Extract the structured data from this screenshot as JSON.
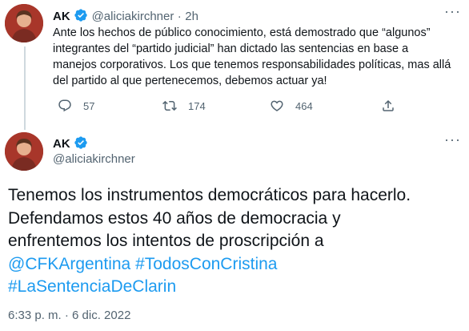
{
  "tweet1": {
    "author_name": "AK",
    "handle": "@aliciakirchner",
    "separator": "·",
    "time_ago": "2h",
    "more": "···",
    "text": "Ante los hechos de público conocimiento, está demostrado que “algunos” integrantes del “partido judicial” han dictado las sentencias en base a manejos corporativos. Los que tenemos responsabilidades políticas, mas allá del partido al que pertenecemos, debemos actuar ya!",
    "replies": "57",
    "retweets": "174",
    "likes": "464"
  },
  "tweet2": {
    "author_name": "AK",
    "handle": "@aliciakirchner",
    "more": "···",
    "text_line1": "Tenemos los instrumentos democráticos para hacerlo.",
    "text_line2": "Defendamos estos 40 años de democracia y",
    "text_line3": "enfrentemos los intentos de proscripción a",
    "mention": "@CFKArgentina",
    "hashtag1": "#TodosConCristina",
    "hashtag2": "#LaSentenciaDeClarin",
    "timestamp": "6:33 p. m. · 6 dic. 2022"
  },
  "colors": {
    "link": "#1d9bf0",
    "verified": "#1d9bf0",
    "secondary_text": "#536471",
    "thread_line": "#cfd9de"
  },
  "icons": [
    "verified-badge-icon",
    "more-icon",
    "reply-icon",
    "retweet-icon",
    "like-icon",
    "share-icon"
  ]
}
